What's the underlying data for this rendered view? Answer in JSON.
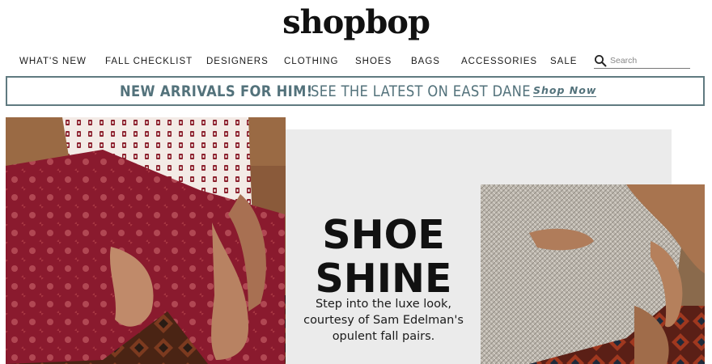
{
  "brand": {
    "logo_text": "shopbop"
  },
  "nav": {
    "items": [
      {
        "label": "WHAT'S NEW"
      },
      {
        "label": "FALL CHECKLIST"
      },
      {
        "label": "DESIGNERS"
      },
      {
        "label": "CLOTHING"
      },
      {
        "label": "SHOES"
      },
      {
        "label": "BAGS"
      },
      {
        "label": "ACCESSORIES"
      },
      {
        "label": "SALE"
      }
    ],
    "search": {
      "placeholder": "Search",
      "value": "",
      "icon": "search-icon"
    }
  },
  "promo": {
    "bold_text": "NEW ARRIVALS FOR HIM!",
    "light_text": "SEE THE LATEST ON EAST DANE",
    "link_label": "Shop Now",
    "color": "#53727b"
  },
  "hero": {
    "title_line1": "SHOE",
    "title_line2": "SHINE",
    "desc_line1": "Step into the luxe look,",
    "desc_line2": "courtesy of Sam Edelman's",
    "desc_line3": "opulent fall pairs.",
    "panel_color": "#ebebeb"
  }
}
